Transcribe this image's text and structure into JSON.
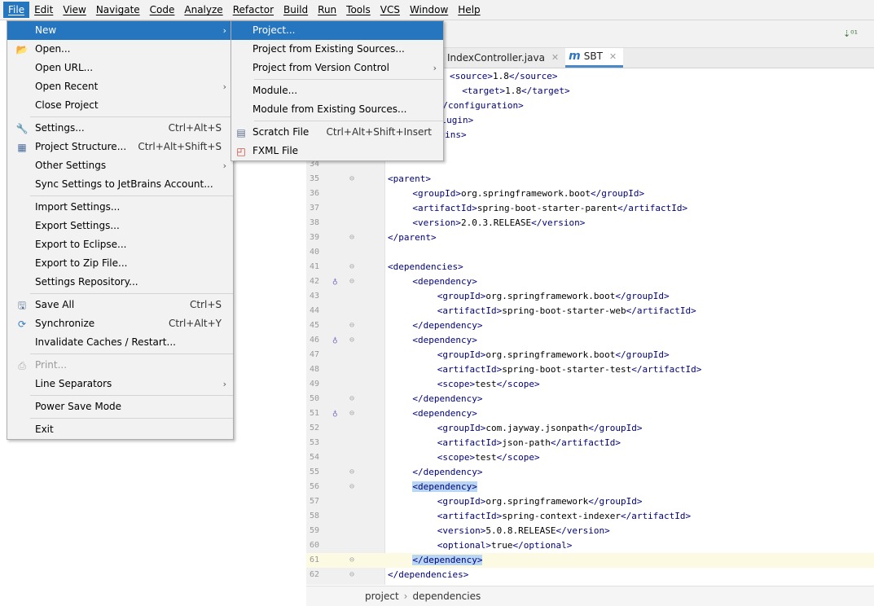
{
  "menubar": [
    "File",
    "Edit",
    "View",
    "Navigate",
    "Code",
    "Analyze",
    "Refactor",
    "Build",
    "Run",
    "Tools",
    "VCS",
    "Window",
    "Help"
  ],
  "tabs": [
    {
      "label": "IndexController.java",
      "active": false
    },
    {
      "label": "SBT",
      "active": true,
      "prefix": "m"
    }
  ],
  "file_menu": [
    {
      "label": "New",
      "arrow": true,
      "selected": true
    },
    {
      "label": "Open...",
      "icon": "folder-icon"
    },
    {
      "label": "Open URL..."
    },
    {
      "label": "Open Recent",
      "arrow": true
    },
    {
      "label": "Close Project"
    },
    {
      "sep": true
    },
    {
      "label": "Settings...",
      "shortcut": "Ctrl+Alt+S",
      "icon": "wrench-icon"
    },
    {
      "label": "Project Structure...",
      "shortcut": "Ctrl+Alt+Shift+S",
      "icon": "structure-icon"
    },
    {
      "label": "Other Settings",
      "arrow": true
    },
    {
      "label": "Sync Settings to JetBrains Account..."
    },
    {
      "sep": true
    },
    {
      "label": "Import Settings..."
    },
    {
      "label": "Export Settings..."
    },
    {
      "label": "Export to Eclipse..."
    },
    {
      "label": "Export to Zip File..."
    },
    {
      "label": "Settings Repository..."
    },
    {
      "sep": true
    },
    {
      "label": "Save All",
      "shortcut": "Ctrl+S",
      "icon": "save-icon"
    },
    {
      "label": "Synchronize",
      "shortcut": "Ctrl+Alt+Y",
      "icon": "sync-icon"
    },
    {
      "label": "Invalidate Caches / Restart..."
    },
    {
      "sep": true
    },
    {
      "label": "Print...",
      "disabled": true,
      "icon": "printer-icon"
    },
    {
      "label": "Line Separators",
      "arrow": true
    },
    {
      "sep": true
    },
    {
      "label": "Power Save Mode"
    },
    {
      "sep": true
    },
    {
      "label": "Exit"
    }
  ],
  "new_menu": [
    {
      "label": "Project...",
      "selected": true
    },
    {
      "label": "Project from Existing Sources..."
    },
    {
      "label": "Project from Version Control",
      "arrow": true
    },
    {
      "sep": true
    },
    {
      "label": "Module..."
    },
    {
      "label": "Module from Existing Sources..."
    },
    {
      "sep": true
    },
    {
      "label": "Scratch File",
      "shortcut": "Ctrl+Alt+Shift+Insert",
      "icon": "scratch-file-icon"
    },
    {
      "label": "FXML File",
      "icon": "fxml-file-icon"
    }
  ],
  "code_lines": [
    {
      "num": "",
      "code": [
        [
          "tag",
          "<source>"
        ],
        [
          "txt",
          "1.8"
        ],
        [
          "tag",
          "</source>"
        ]
      ],
      "indent": 10
    },
    {
      "num": "",
      "code": [
        [
          "tag",
          "<target>"
        ],
        [
          "txt",
          "1.8"
        ],
        [
          "tag",
          "</target>"
        ]
      ],
      "indent": 12
    },
    {
      "num": "",
      "code": [
        [
          "tag",
          "</configuration>"
        ]
      ],
      "indent": 8
    },
    {
      "num": "",
      "code": [
        [
          "tag",
          "</plugin>"
        ]
      ],
      "indent": 6
    },
    {
      "num": "",
      "code": [
        [
          "tag",
          "</plugins>"
        ]
      ],
      "indent": 4
    },
    {
      "num": "",
      "code": [],
      "indent": 0
    },
    {
      "num": "34",
      "code": [],
      "indent": 0
    },
    {
      "num": "35",
      "code": [
        [
          "tag",
          "<parent>"
        ]
      ],
      "indent": 0,
      "fold": "⊖"
    },
    {
      "num": "36",
      "code": [
        [
          "tag",
          "<groupId>"
        ],
        [
          "txt",
          "org.springframework.boot"
        ],
        [
          "tag",
          "</groupId>"
        ]
      ],
      "indent": 4
    },
    {
      "num": "37",
      "code": [
        [
          "tag",
          "<artifactId>"
        ],
        [
          "txt",
          "spring-boot-starter-parent"
        ],
        [
          "tag",
          "</artifactId>"
        ]
      ],
      "indent": 4
    },
    {
      "num": "38",
      "code": [
        [
          "tag",
          "<version>"
        ],
        [
          "txt",
          "2.0.3.RELEASE"
        ],
        [
          "tag",
          "</version>"
        ]
      ],
      "indent": 4
    },
    {
      "num": "39",
      "code": [
        [
          "tag",
          "</parent>"
        ]
      ],
      "indent": 0,
      "fold": "⊖"
    },
    {
      "num": "40",
      "code": [],
      "indent": 0
    },
    {
      "num": "41",
      "code": [
        [
          "tag",
          "<dependencies>"
        ]
      ],
      "indent": 0,
      "fold": "⊖"
    },
    {
      "num": "42",
      "code": [
        [
          "tag",
          "<dependency>"
        ]
      ],
      "indent": 4,
      "fold": "⊖",
      "mark": true
    },
    {
      "num": "43",
      "code": [
        [
          "tag",
          "<groupId>"
        ],
        [
          "txt",
          "org.springframework.boot"
        ],
        [
          "tag",
          "</groupId>"
        ]
      ],
      "indent": 8
    },
    {
      "num": "44",
      "code": [
        [
          "tag",
          "<artifactId>"
        ],
        [
          "txt",
          "spring-boot-starter-web"
        ],
        [
          "tag",
          "</artifactId>"
        ]
      ],
      "indent": 8
    },
    {
      "num": "45",
      "code": [
        [
          "tag",
          "</dependency>"
        ]
      ],
      "indent": 4,
      "fold": "⊖"
    },
    {
      "num": "46",
      "code": [
        [
          "tag",
          "<dependency>"
        ]
      ],
      "indent": 4,
      "fold": "⊖",
      "mark": true
    },
    {
      "num": "47",
      "code": [
        [
          "tag",
          "<groupId>"
        ],
        [
          "txt",
          "org.springframework.boot"
        ],
        [
          "tag",
          "</groupId>"
        ]
      ],
      "indent": 8
    },
    {
      "num": "48",
      "code": [
        [
          "tag",
          "<artifactId>"
        ],
        [
          "txt",
          "spring-boot-starter-test"
        ],
        [
          "tag",
          "</artifactId>"
        ]
      ],
      "indent": 8
    },
    {
      "num": "49",
      "code": [
        [
          "tag",
          "<scope>"
        ],
        [
          "txt",
          "test"
        ],
        [
          "tag",
          "</scope>"
        ]
      ],
      "indent": 8
    },
    {
      "num": "50",
      "code": [
        [
          "tag",
          "</dependency>"
        ]
      ],
      "indent": 4,
      "fold": "⊖"
    },
    {
      "num": "51",
      "code": [
        [
          "tag",
          "<dependency>"
        ]
      ],
      "indent": 4,
      "fold": "⊖",
      "mark": true
    },
    {
      "num": "52",
      "code": [
        [
          "tag",
          "<groupId>"
        ],
        [
          "txt",
          "com.jayway.jsonpath"
        ],
        [
          "tag",
          "</groupId>"
        ]
      ],
      "indent": 8
    },
    {
      "num": "53",
      "code": [
        [
          "tag",
          "<artifactId>"
        ],
        [
          "txt",
          "json-path"
        ],
        [
          "tag",
          "</artifactId>"
        ]
      ],
      "indent": 8
    },
    {
      "num": "54",
      "code": [
        [
          "tag",
          "<scope>"
        ],
        [
          "txt",
          "test"
        ],
        [
          "tag",
          "</scope>"
        ]
      ],
      "indent": 8
    },
    {
      "num": "55",
      "code": [
        [
          "tag",
          "</dependency>"
        ]
      ],
      "indent": 4,
      "fold": "⊖"
    },
    {
      "num": "56",
      "code": [
        [
          "tagsel",
          "<dependency>"
        ]
      ],
      "indent": 4,
      "fold": "⊖"
    },
    {
      "num": "57",
      "code": [
        [
          "tag",
          "<groupId>"
        ],
        [
          "txt",
          "org.springframework"
        ],
        [
          "tag",
          "</groupId>"
        ]
      ],
      "indent": 8
    },
    {
      "num": "58",
      "code": [
        [
          "tag",
          "<artifactId>"
        ],
        [
          "txt",
          "spring-context-indexer"
        ],
        [
          "tag",
          "</artifactId>"
        ]
      ],
      "indent": 8
    },
    {
      "num": "59",
      "code": [
        [
          "tag",
          "<version>"
        ],
        [
          "txt",
          "5.0.8.RELEASE"
        ],
        [
          "tag",
          "</version>"
        ]
      ],
      "indent": 8
    },
    {
      "num": "60",
      "code": [
        [
          "tag",
          "<optional>"
        ],
        [
          "txt",
          "true"
        ],
        [
          "tag",
          "</optional>"
        ]
      ],
      "indent": 8
    },
    {
      "num": "61",
      "code": [
        [
          "tagsel",
          "</dependency>"
        ]
      ],
      "indent": 4,
      "fold": "⊖",
      "hl": true
    },
    {
      "num": "62",
      "code": [
        [
          "tag",
          "</dependencies>"
        ]
      ],
      "indent": 0,
      "fold": "⊖"
    }
  ],
  "breadcrumb": {
    "items": [
      "project",
      "dependencies"
    ],
    "sep": "›"
  },
  "colors": {
    "accent": "#2675bf",
    "tag": "#000080"
  }
}
